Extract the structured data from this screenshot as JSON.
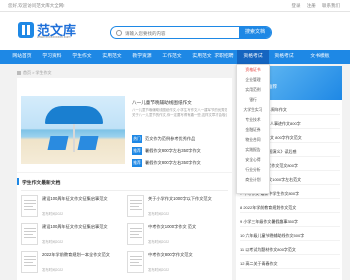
{
  "topbar": {
    "greeting": "您好,欢迎访问范文库大全网!",
    "links": [
      "登录",
      "注册",
      "联系我们"
    ]
  },
  "header": {
    "logo_text": "范文库",
    "logo_sub": "www.xxxxxxxxxx.com",
    "search_placeholder": "请输入您要找的内容",
    "search_button": "搜索文档"
  },
  "nav": {
    "items": [
      "网站首页",
      "学习资料",
      "学生作文",
      "实用范文",
      "教学资源",
      "工作范文",
      "实用范文",
      "求职招聘",
      "资格考试",
      "资格考试",
      "文书模板"
    ]
  },
  "dropdown": {
    "items": [
      "资格证书",
      "企业管理",
      "实用范例",
      "银行",
      "大学生实习",
      "专业技术",
      "金融证券",
      "物业合同",
      "实践报告",
      "安全心得",
      "行业分析",
      "商业计划"
    ]
  },
  "breadcrumb": {
    "text": "首页 > 学生作文"
  },
  "promo": {
    "title": "八一儿童节晚辅助线图纸作文",
    "desc": [
      "八一儿童节晚辅助线图纸作文,小学生写作文八一建军节的优秀范文。",
      "关于八一儿童节的作文,你一定要写得有趣一些,这样文章才会吸引人。"
    ],
    "items": [
      {
        "badge": "热门",
        "text": "范文作为范例参考优秀作品"
      },
      {
        "badge": "推荐",
        "text": "暑假作文800字左右350字作文"
      },
      {
        "badge": "推荐",
        "text": "暑假作文800字左右350字作文"
      }
    ]
  },
  "section": {
    "title": "学生作文最新文档",
    "docs": [
      {
        "title": "建设100周年征文作文征集启事范文",
        "meta": "发布时间2022"
      },
      {
        "title": "关于小学作文1000字以下作文范文",
        "meta": "发布时间2022"
      },
      {
        "title": "建设100周年征文作文征集启事范文",
        "meta": "发布时间2022"
      },
      {
        "title": "中考作文1000字作文 范文",
        "meta": "发布时间2022"
      },
      {
        "title": "2022年学前教育规划一本全作文范文",
        "meta": "发布时间2022"
      },
      {
        "title": "中考作文800字作文范文",
        "meta": "发布时间2022"
      }
    ]
  },
  "side": {
    "title": "热门推荐",
    "ranks": [
      "1 2022年建党101周年作文",
      "2 建设100周年感人事迹作文800字",
      "3 建设100周年作文 800字作文范文",
      "4 满分作文 《三国演义》读后感",
      "5 关于学习新时代作文范文800字",
      "6 2022年高考作文1000字左右范文",
      "7 中考作文 最新中学生作文800字",
      "8 2022年学前教育规划作文范文",
      "9 小学三年级作文暑假趣事350字",
      "10 六年级儿童节晚辅助线作文500字",
      "11 以考试为题材作文800字范文",
      "12 高二关于青春作文"
    ]
  },
  "colors": {
    "accent": "#1e88e5",
    "nav_active": "#1565c0",
    "hot": "#e53935"
  }
}
